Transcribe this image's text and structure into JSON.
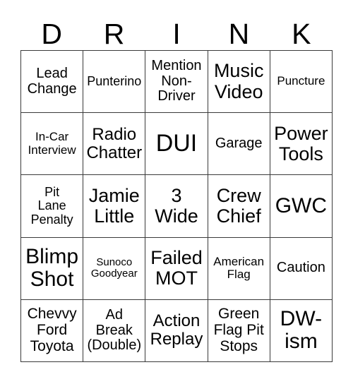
{
  "card": {
    "title_letters": [
      "D",
      "R",
      "I",
      "N",
      "K"
    ],
    "columns": 5,
    "rows": 5,
    "border_color": "#3a3a3a",
    "background_color": "#ffffff",
    "text_color": "#000000"
  },
  "cells": [
    {
      "text": "Lead\nChange",
      "size": "sz-md"
    },
    {
      "text": "Punterino",
      "size": "sz-smm"
    },
    {
      "text": "Mention\nNon-\nDriver",
      "size": "sz-md"
    },
    {
      "text": "Music\nVideo",
      "size": "sz-xl"
    },
    {
      "text": "Puncture",
      "size": "sz-sm"
    },
    {
      "text": "In-Car\nInterview",
      "size": "sz-sm"
    },
    {
      "text": "Radio\nChatter",
      "size": "sz-lg"
    },
    {
      "text": "DUI",
      "size": "sz-huge"
    },
    {
      "text": "Garage",
      "size": "sz-md"
    },
    {
      "text": "Power\nTools",
      "size": "sz-xl"
    },
    {
      "text": "Pit\nLane\nPenalty",
      "size": "sz-smm"
    },
    {
      "text": "Jamie\nLittle",
      "size": "sz-xl"
    },
    {
      "text": "3\nWide",
      "size": "sz-xl"
    },
    {
      "text": "Crew\nChief",
      "size": "sz-xl"
    },
    {
      "text": "GWC",
      "size": "sz-xxl"
    },
    {
      "text": "Blimp\nShot",
      "size": "sz-xxl"
    },
    {
      "text": "Sunoco\nGoodyear",
      "size": "sz-xs"
    },
    {
      "text": "Failed\nMOT",
      "size": "sz-xl"
    },
    {
      "text": "American\nFlag",
      "size": "sz-sm"
    },
    {
      "text": "Caution",
      "size": "sz-md"
    },
    {
      "text": "Chevvy\nFord\nToyota",
      "size": "sz-mdp"
    },
    {
      "text": "Ad\nBreak\n(Double)",
      "size": "sz-md"
    },
    {
      "text": "Action\nReplay",
      "size": "sz-lg"
    },
    {
      "text": "Green\nFlag Pit\nStops",
      "size": "sz-mdp"
    },
    {
      "text": "DW-\nism",
      "size": "sz-xxl"
    }
  ]
}
